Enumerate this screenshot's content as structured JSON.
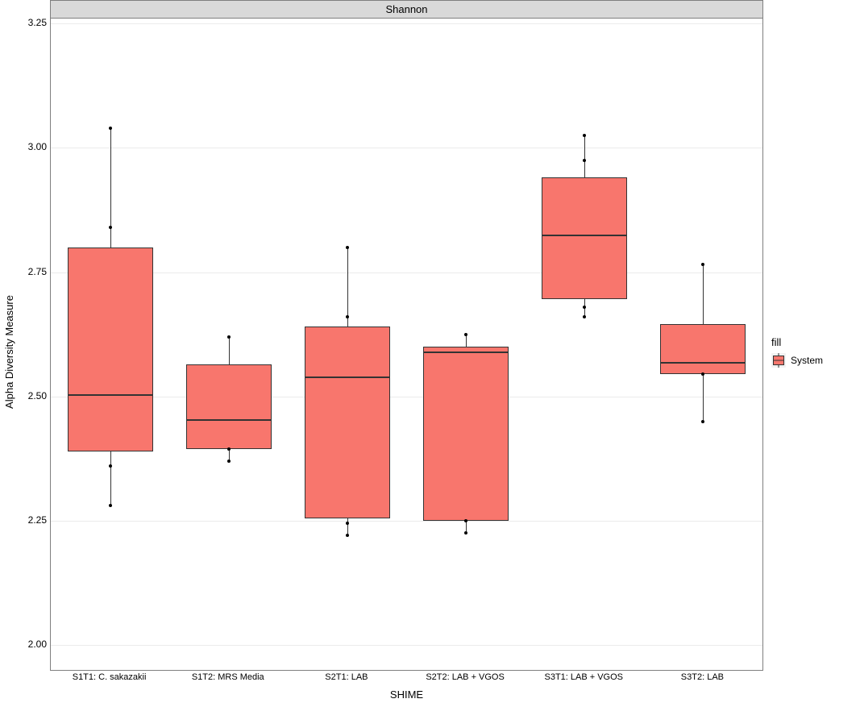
{
  "chart_data": {
    "type": "boxplot",
    "facet": "Shannon",
    "xlabel": "SHIME",
    "ylabel": "Alpha Diversity Measure",
    "ylim": [
      1.95,
      3.26
    ],
    "yticks": [
      2.0,
      2.25,
      2.5,
      2.75,
      3.0,
      3.25
    ],
    "fill_legend_title": "fill",
    "fill_legend_label": "System",
    "fill_color": "#f8766d",
    "categories": [
      "S1T1: C. sakazakii",
      "S1T2: MRS Media",
      "S2T1: LAB",
      "S2T2: LAB + VGOS",
      "S3T1: LAB + VGOS",
      "S3T2: LAB"
    ],
    "series": [
      {
        "name": "S1T1: C. sakazakii",
        "q1": 2.39,
        "median": 2.505,
        "q3": 2.8,
        "whisker_low": 2.28,
        "whisker_high": 3.04,
        "points": [
          2.28,
          2.36,
          2.84,
          3.04
        ]
      },
      {
        "name": "S1T2: MRS Media",
        "q1": 2.395,
        "median": 2.455,
        "q3": 2.565,
        "whisker_low": 2.37,
        "whisker_high": 2.62,
        "points": [
          2.37,
          2.395,
          2.62
        ]
      },
      {
        "name": "S2T1: LAB",
        "q1": 2.255,
        "median": 2.54,
        "q3": 2.64,
        "whisker_low": 2.22,
        "whisker_high": 2.8,
        "points": [
          2.22,
          2.245,
          2.66,
          2.8
        ]
      },
      {
        "name": "S2T2: LAB + VGOS",
        "q1": 2.25,
        "median": 2.59,
        "q3": 2.6,
        "whisker_low": 2.225,
        "whisker_high": 2.625,
        "points": [
          2.225,
          2.25,
          2.625
        ]
      },
      {
        "name": "S3T1: LAB + VGOS",
        "q1": 2.695,
        "median": 2.825,
        "q3": 2.94,
        "whisker_low": 2.66,
        "whisker_high": 3.025,
        "points": [
          2.66,
          2.68,
          2.975,
          3.025
        ]
      },
      {
        "name": "S3T2: LAB",
        "q1": 2.545,
        "median": 2.57,
        "q3": 2.645,
        "whisker_low": 2.45,
        "whisker_high": 2.765,
        "points": [
          2.45,
          2.545,
          2.765
        ]
      }
    ]
  }
}
